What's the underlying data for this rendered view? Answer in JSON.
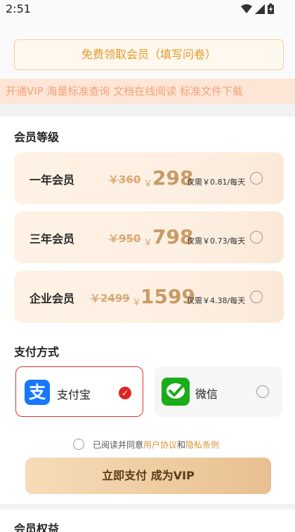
{
  "status_bar": {
    "time": "2:51"
  },
  "free_button": {
    "label": "免费领取会员（填写问卷）"
  },
  "marquee": {
    "text": "开通VIP 海量标准查询 文档在线阅读 标准文件下载"
  },
  "membership": {
    "title": "会员等级",
    "plans": [
      {
        "name": "一年会员",
        "old_price": "￥360",
        "currency": "￥",
        "price": "298",
        "per_day": "仅需￥0.81/每天"
      },
      {
        "name": "三年会员",
        "old_price": "￥950",
        "currency": "￥",
        "price": "798",
        "per_day": "仅需￥0.73/每天"
      },
      {
        "name": "企业会员",
        "old_price": "￥2499",
        "currency": "￥",
        "price": "1599",
        "per_day": "仅需￥4.38/每天"
      }
    ]
  },
  "payment": {
    "title": "支付方式",
    "methods": [
      {
        "name": "支付宝",
        "selected": true
      },
      {
        "name": "微信",
        "selected": false
      }
    ]
  },
  "agreement": {
    "prefix": "已阅读并同意",
    "user_agreement": "用户协议",
    "and": "和",
    "privacy": "隐私条例"
  },
  "pay_now": {
    "label": "立即支付 成为VIP"
  },
  "benefits": {
    "title": "会员权益"
  },
  "colors": {
    "accent": "#c99a66",
    "selected_red": "#e02424",
    "alipay_blue": "#1677ff",
    "wechat_green": "#1aad19"
  }
}
